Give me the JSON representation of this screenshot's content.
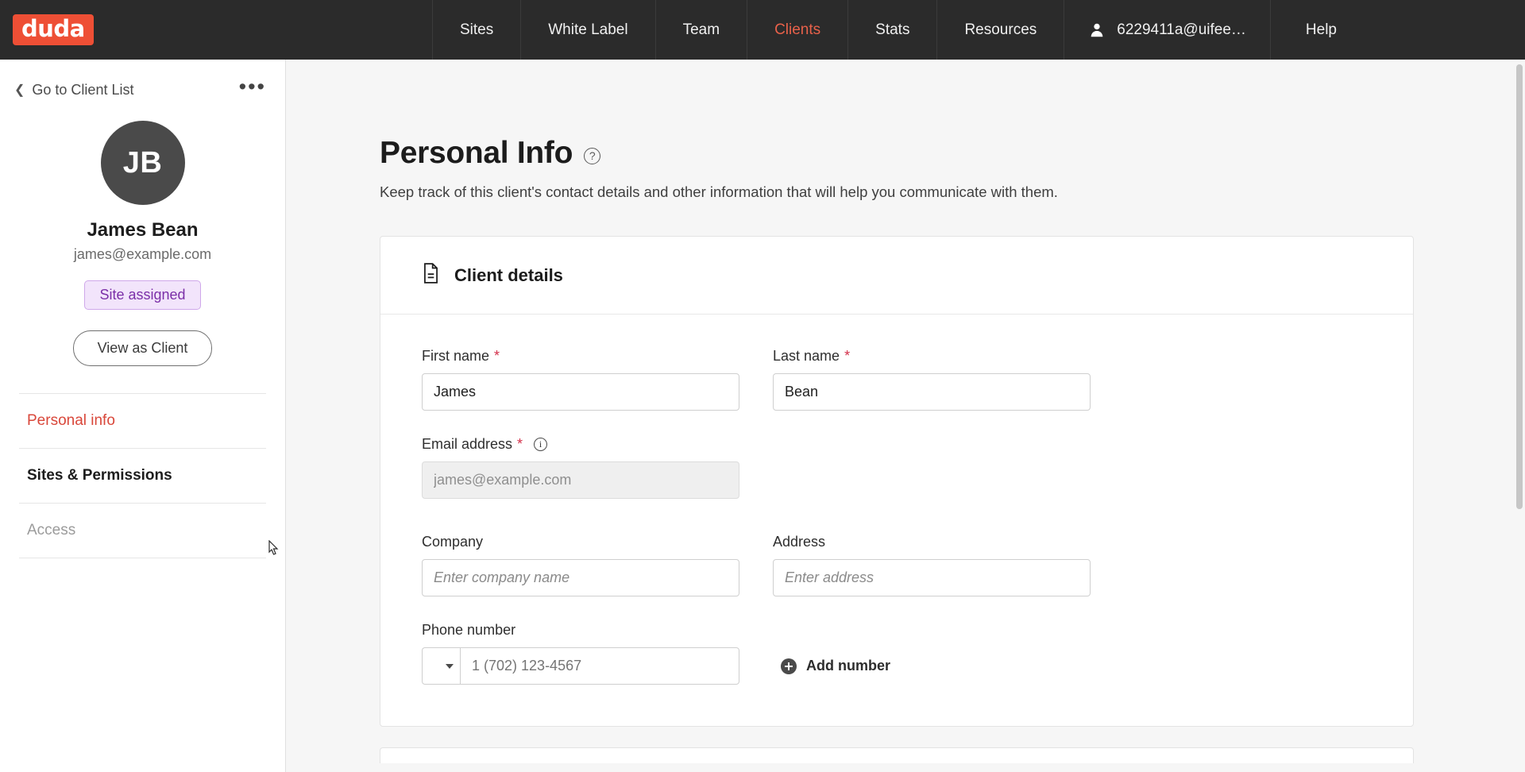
{
  "topnav": {
    "logo_text": "duda",
    "items": [
      {
        "label": "Sites",
        "active": false
      },
      {
        "label": "White Label",
        "active": false
      },
      {
        "label": "Team",
        "active": false
      },
      {
        "label": "Clients",
        "active": true
      },
      {
        "label": "Stats",
        "active": false
      },
      {
        "label": "Resources",
        "active": false
      }
    ],
    "user_label": "6229411a@uifee…",
    "help_label": "Help",
    "accent_color": "#e8614a",
    "background_color": "#2b2b2b"
  },
  "sidebar": {
    "back_label": "Go to Client List",
    "more_label": "•••",
    "avatar_initials": "JB",
    "client_name": "James Bean",
    "client_email": "james@example.com",
    "badge_label": "Site assigned",
    "badge_color": "#7b2fa8",
    "view_as_client_label": "View as Client",
    "links": [
      {
        "label": "Personal info",
        "state": "current"
      },
      {
        "label": "Sites & Permissions",
        "state": "bold"
      },
      {
        "label": "Access",
        "state": "muted"
      }
    ]
  },
  "main": {
    "title": "Personal Info",
    "help_icon_label": "?",
    "subtitle": "Keep track of this client's contact details and other information that will help you communicate with them.",
    "card": {
      "header_title": "Client details",
      "fields": {
        "first_name": {
          "label": "First name",
          "required": "*",
          "value": "James",
          "placeholder": ""
        },
        "last_name": {
          "label": "Last name",
          "required": "*",
          "value": "Bean",
          "placeholder": ""
        },
        "email": {
          "label": "Email address",
          "required": "*",
          "value": "",
          "placeholder": "james@example.com"
        },
        "company": {
          "label": "Company",
          "value": "",
          "placeholder": "Enter company name"
        },
        "address": {
          "label": "Address",
          "value": "",
          "placeholder": "Enter address"
        },
        "phone": {
          "label": "Phone number",
          "country_code": "",
          "value": "",
          "placeholder": "1 (702) 123-4567",
          "add_label": "Add number"
        }
      }
    }
  }
}
